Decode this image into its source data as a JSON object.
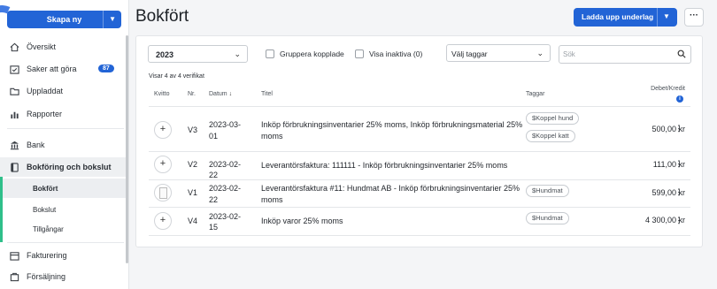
{
  "sidebar": {
    "create_label": "Skapa ny",
    "items": [
      {
        "label": "Översikt",
        "icon": "home-icon"
      },
      {
        "label": "Saker att göra",
        "icon": "calendar-check-icon",
        "badge": "87"
      },
      {
        "label": "Uppladdat",
        "icon": "folder-icon"
      },
      {
        "label": "Rapporter",
        "icon": "bar-chart-icon"
      },
      {
        "label": "Bank",
        "icon": "bank-icon"
      },
      {
        "label": "Bokföring och bokslut",
        "icon": "book-icon"
      },
      {
        "label": "Fakturering",
        "icon": "invoice-icon"
      },
      {
        "label": "Försäljning",
        "icon": "cart-icon"
      }
    ],
    "subitems": [
      "Bokfört",
      "Bokslut",
      "Tillgångar"
    ]
  },
  "header": {
    "title": "Bokfört",
    "upload_label": "Ladda upp underlag",
    "more_label": "···"
  },
  "filters": {
    "year": "2023",
    "group_label": "Gruppera kopplade",
    "inactive_label": "Visa inaktiva (0)",
    "tags_placeholder": "Välj taggar",
    "search_placeholder": "Sök"
  },
  "table": {
    "summary": "Visar 4 av 4 verifikat",
    "headers": {
      "kvitto": "Kvitto",
      "nr": "Nr.",
      "datum": "Datum",
      "titel": "Titel",
      "taggar": "Taggar",
      "debet_kredit": "Debet/Kredit"
    },
    "rows": [
      {
        "nr": "V3",
        "date1": "2023-03-",
        "date2": "01",
        "title1": "Inköp förbrukningsinventarier 25% moms, Inköp förbrukningsmaterial 25%",
        "title2": "moms",
        "tags": [
          "$Koppel hund",
          "$Koppel katt"
        ],
        "amount": "500,00 kr",
        "receipt": "add"
      },
      {
        "nr": "V2",
        "date1": "2023-02-",
        "date2": "22",
        "title1": "Leverantörsfaktura: 111111 - Inköp förbrukningsinventarier 25% moms",
        "title2": "",
        "tags": [],
        "amount": "111,00 kr",
        "receipt": "add"
      },
      {
        "nr": "V1",
        "date1": "2023-02-",
        "date2": "22",
        "title1": "Leverantörsfaktura #11: Hundmat AB - Inköp förbrukningsinventarier 25%",
        "title2": "moms",
        "tags": [
          "$Hundmat"
        ],
        "amount": "599,00 kr",
        "receipt": "thumbnail"
      },
      {
        "nr": "V4",
        "date1": "2023-02-",
        "date2": "15",
        "title1": "Inköp varor 25% moms",
        "title2": "",
        "tags": [
          "$Hundmat"
        ],
        "amount": "4 300,00 kr",
        "receipt": "add"
      }
    ]
  },
  "colors": {
    "accent": "#2264d6",
    "active_bar": "#2fbf8a"
  }
}
